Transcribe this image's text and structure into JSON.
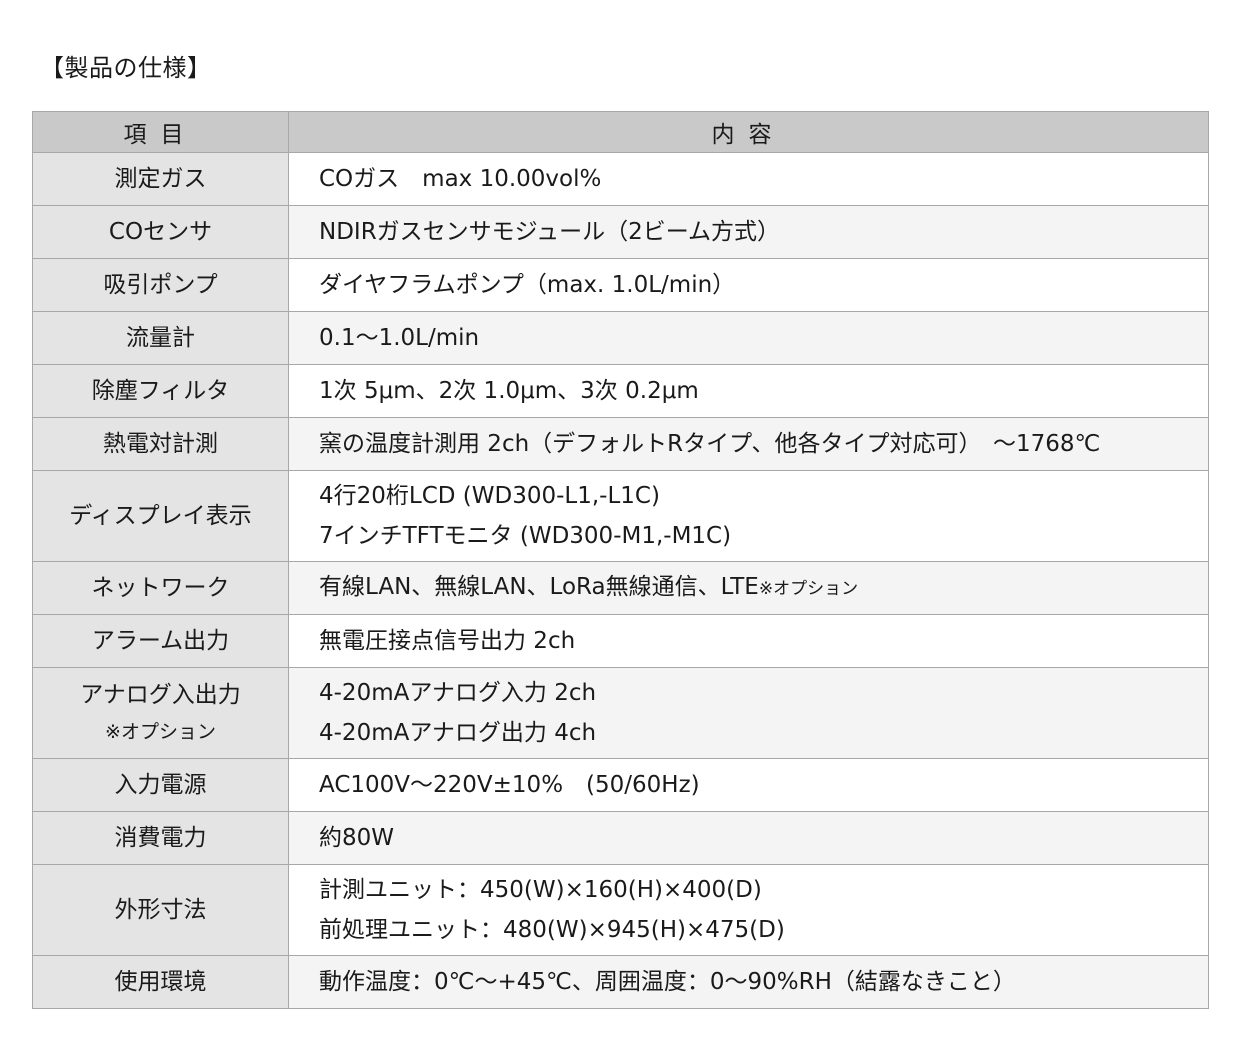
{
  "title": "【製品の仕様】",
  "header": {
    "item": "項目",
    "content": "内容"
  },
  "rows": [
    {
      "item": "測定ガス",
      "lines": [
        "COガス　max 10.00vol%"
      ]
    },
    {
      "item": "COセンサ",
      "lines": [
        "NDIRガスセンサモジュール（2ビーム方式）"
      ]
    },
    {
      "item": "吸引ポンプ",
      "lines": [
        "ダイヤフラムポンプ（max. 1.0L/min）"
      ]
    },
    {
      "item": "流量計",
      "lines": [
        "0.1〜1.0L/min"
      ]
    },
    {
      "item": "除塵フィルタ",
      "lines": [
        "1次 5μm、2次 1.0μm、3次 0.2μm"
      ]
    },
    {
      "item": "熱電対計測",
      "lines": [
        "窯の温度計測用 2ch（デフォルトRタイプ、他各タイプ対応可）　～1768℃"
      ]
    },
    {
      "item": "ディスプレイ表示",
      "lines": [
        "4行20桁LCD (WD300-L1,-L1C)",
        "7インチTFTモニタ (WD300-M1,-M1C)"
      ]
    },
    {
      "item": "ネットワーク",
      "text": "有線LAN、無線LAN、LoRa無線通信、LTE",
      "note": "※オプション"
    },
    {
      "item": "アラーム出力",
      "lines": [
        "無電圧接点信号出力 2ch"
      ]
    },
    {
      "item": "アナログ入出力",
      "item_note": "※オプション",
      "lines": [
        "4-20mAアナログ入力 2ch",
        "4-20mAアナログ出力 4ch"
      ]
    },
    {
      "item": "入力電源",
      "lines": [
        "AC100V〜220V±10%　(50/60Hz)"
      ]
    },
    {
      "item": "消費電力",
      "lines": [
        "約80W"
      ]
    },
    {
      "item": "外形寸法",
      "lines": [
        "計測ユニット：450(W)×160(H)×400(D)",
        "前処理ユニット：480(W)×945(H)×475(D)"
      ]
    },
    {
      "item": "使用環境",
      "lines": [
        "動作温度：0℃〜+45℃、周囲温度：0〜90%RH（結露なきこと）"
      ]
    }
  ]
}
